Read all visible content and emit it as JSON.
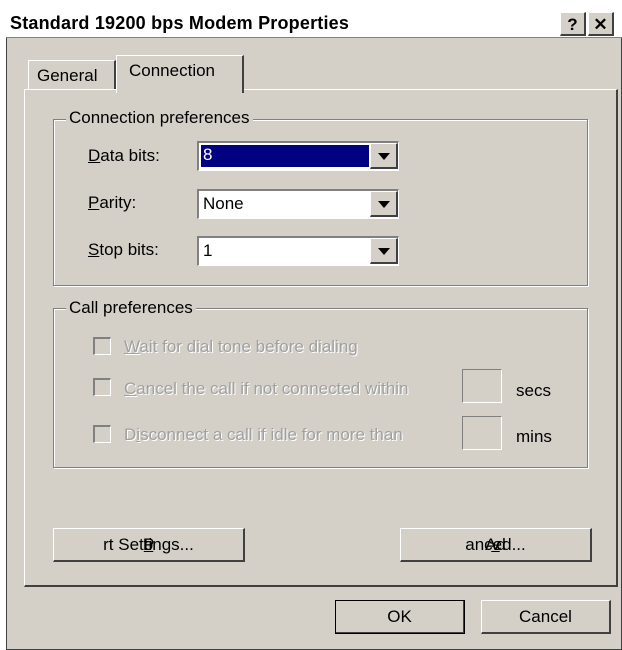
{
  "window": {
    "title": "Standard 19200 bps Modem Properties",
    "help_label": "?",
    "close_label": "✕"
  },
  "tabs": [
    {
      "label": "General"
    },
    {
      "label": "Connection"
    }
  ],
  "connection_preferences": {
    "legend": "Connection preferences",
    "data_bits": {
      "accel": "D",
      "rest": "ata bits:",
      "value": "8"
    },
    "parity": {
      "accel": "P",
      "rest": "arity:",
      "value": "None"
    },
    "stop_bits": {
      "accel": "S",
      "rest": "top bits:",
      "value": "1"
    }
  },
  "call_preferences": {
    "legend": "Call preferences",
    "wait_dial_tone": {
      "accel": "W",
      "rest": "ait for dial tone before dialing"
    },
    "cancel_call": {
      "accel": "C",
      "rest": "ancel the call if not connected within",
      "unit": "secs"
    },
    "disconnect_idle": {
      "pre": "D",
      "accel": "i",
      "rest": "sconnect a call if idle for more than",
      "unit": "mins"
    }
  },
  "buttons": {
    "port_settings": {
      "pre": "P",
      "accel": "o",
      "rest": "rt Settings..."
    },
    "advanced": {
      "pre": "Ad",
      "accel": "v",
      "rest": "anced..."
    },
    "ok": "OK",
    "cancel": "Cancel"
  },
  "colors": {
    "face": "#d4d0c8",
    "highlight": "#000080",
    "disabled_text": "#a0a0a0"
  }
}
